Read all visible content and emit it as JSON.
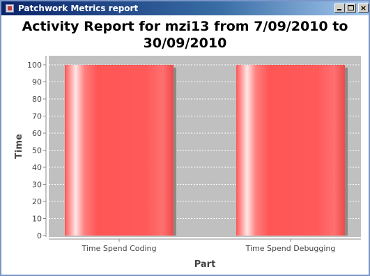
{
  "window": {
    "title": "Patchwork Metrics report",
    "minimize_glyph": "",
    "maximize_glyph": "",
    "close_glyph": "×"
  },
  "chart_data": {
    "type": "bar",
    "title_line1": "Activity Report for mzi13 from 7/09/2010 to",
    "title_line2": "30/09/2010",
    "xlabel": "Part",
    "ylabel": "Time",
    "categories": [
      "Time Spend Coding",
      "Time Spend Debugging"
    ],
    "values": [
      100,
      100
    ],
    "ylim": [
      0,
      105
    ],
    "yticks": [
      0,
      10,
      20,
      30,
      40,
      50,
      60,
      70,
      80,
      90,
      100
    ],
    "grid": true,
    "bar_color": "#ff5555",
    "plot_background": "#c0c0c0",
    "gridline_color": "#ffffff"
  }
}
